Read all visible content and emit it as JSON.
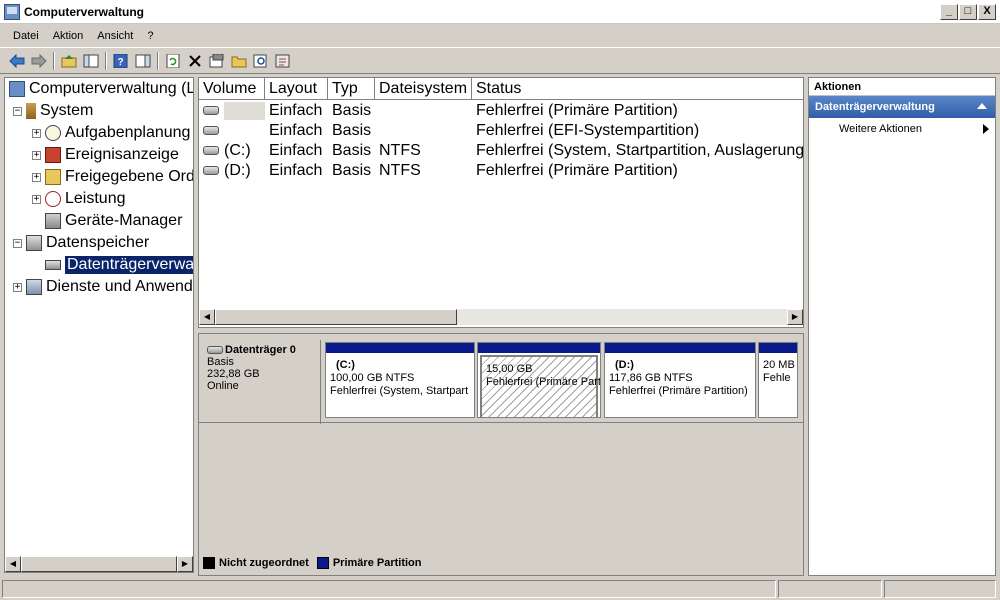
{
  "window": {
    "title": "Computerverwaltung",
    "controls": [
      "_",
      "□",
      "X"
    ]
  },
  "menu": [
    "Datei",
    "Aktion",
    "Ansicht",
    "?"
  ],
  "toolbar": {
    "icons": [
      "back-arrow-icon",
      "forward-arrow-icon",
      "up-folder-icon",
      "show-hide-tree-icon",
      "help-icon",
      "properties-pane-icon",
      "refresh-icon",
      "delete-icon",
      "properties-icon",
      "open-folder-icon",
      "search-icon",
      "settings-icon"
    ]
  },
  "tree": {
    "root": "Computerverwaltung (L",
    "system": "System",
    "aufgaben": "Aufgabenplanung",
    "ereignis": "Ereignisanzeige",
    "freigabe": "Freigegebene Ord",
    "leistung": "Leistung",
    "geraete": "Geräte-Manager",
    "datenspeicher": "Datenspeicher",
    "datentraeger": "Datenträgerverwa",
    "dienste": "Dienste und Anwend"
  },
  "volumes": {
    "columns": [
      "Volume",
      "Layout",
      "Typ",
      "Dateisystem",
      "Status"
    ],
    "rows": [
      {
        "volume": "",
        "layout": "Einfach",
        "typ": "Basis",
        "fs": "",
        "status": "Fehlerfrei (Primäre Partition)"
      },
      {
        "volume": "",
        "layout": "Einfach",
        "typ": "Basis",
        "fs": "",
        "status": "Fehlerfrei (EFI-Systempartition)"
      },
      {
        "volume": "(C:)",
        "layout": "Einfach",
        "typ": "Basis",
        "fs": "NTFS",
        "status": "Fehlerfrei (System, Startpartition, Auslagerung"
      },
      {
        "volume": "(D:)",
        "layout": "Einfach",
        "typ": "Basis",
        "fs": "NTFS",
        "status": "Fehlerfrei (Primäre Partition)"
      }
    ]
  },
  "disk": {
    "name": "Datenträger 0",
    "type": "Basis",
    "size": "232,88 GB",
    "state": "Online",
    "partitions": [
      {
        "name": "(C:)",
        "size": "100,00 GB NTFS",
        "status": "Fehlerfrei (System, Startpart"
      },
      {
        "name": "",
        "size": "15,00 GB",
        "status": "Fehlerfrei (Primäre Part"
      },
      {
        "name": "(D:)",
        "size": "117,86 GB NTFS",
        "status": "Fehlerfrei (Primäre Partition)"
      },
      {
        "name": "",
        "size": "20 MB",
        "status": "Fehle"
      }
    ]
  },
  "legend": {
    "unallocated": "Nicht zugeordnet",
    "primary": "Primäre Partition"
  },
  "actions": {
    "title": "Aktionen",
    "section": "Datenträgerverwaltung",
    "more": "Weitere Aktionen"
  },
  "colors": {
    "partition_bar": "#0a1a8c",
    "selection": "#0a246a",
    "actions_header": "#3a68b4"
  }
}
